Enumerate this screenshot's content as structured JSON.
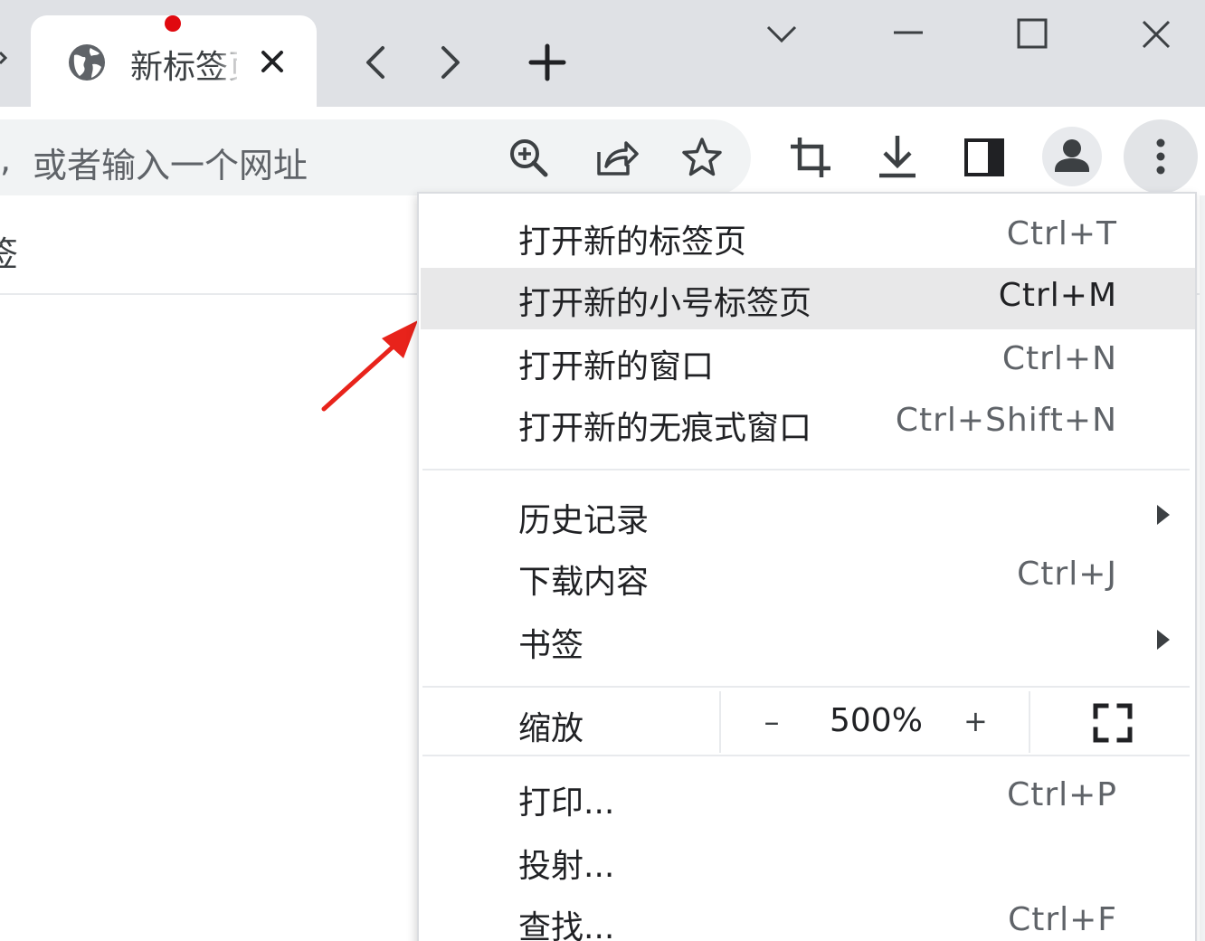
{
  "tab": {
    "title": "新标签页"
  },
  "omnibox": {
    "comma": ",",
    "placeholder": "或者输入一个网址"
  },
  "page": {
    "partial_text": "签"
  },
  "menu": {
    "group1": [
      {
        "label": "打开新的标签页",
        "shortcut": "Ctrl+T"
      },
      {
        "label": "打开新的小号标签页",
        "shortcut": "Ctrl+M",
        "highlighted": true
      },
      {
        "label": "打开新的窗口",
        "shortcut": "Ctrl+N"
      },
      {
        "label": "打开新的无痕式窗口",
        "shortcut": "Ctrl+Shift+N"
      }
    ],
    "group2": [
      {
        "label": "历史记录",
        "submenu": true
      },
      {
        "label": "下载内容",
        "shortcut": "Ctrl+J"
      },
      {
        "label": "书签",
        "submenu": true
      }
    ],
    "zoom": {
      "label": "缩放",
      "minus": "–",
      "value": "500%",
      "plus": "+"
    },
    "group3": [
      {
        "label": "打印...",
        "shortcut": "Ctrl+P"
      },
      {
        "label": "投射...",
        "shortcut": ""
      },
      {
        "label": "查找...",
        "shortcut": "Ctrl+F"
      }
    ]
  },
  "colors": {
    "accent_dot": "#e0090f",
    "annotation_arrow": "#e8231b",
    "tabstrip": "#dfe1e5",
    "highlight": "#e8e8e9"
  },
  "icons": [
    "globe-icon",
    "close-icon",
    "back-icon",
    "forward-icon",
    "plus-icon",
    "chevron-down-icon",
    "minimize-icon",
    "maximize-icon",
    "zoom-in-icon",
    "share-icon",
    "star-icon",
    "crop-icon",
    "download-icon",
    "side-panel-icon",
    "profile-icon",
    "kebab-menu-icon",
    "fullscreen-icon"
  ]
}
